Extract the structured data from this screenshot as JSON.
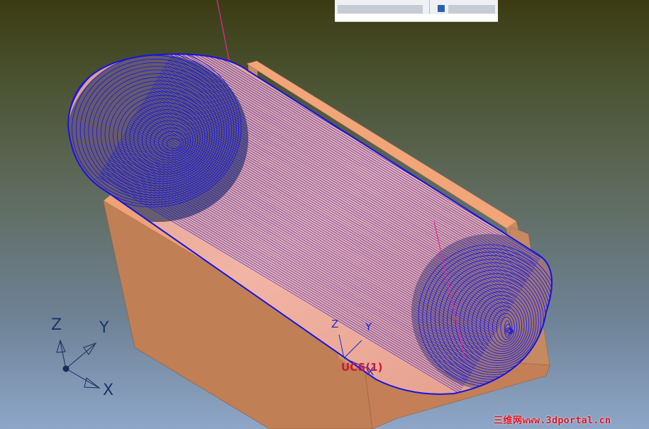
{
  "toolbar": {
    "left_text": "",
    "right_text": ""
  },
  "triad": {
    "z_label": "Z",
    "y_label": "Y",
    "x_label": "X"
  },
  "ucs": {
    "z_label": "Z",
    "y_label": "Y",
    "x_label": "X",
    "name": "UCS(1)"
  },
  "watermark": "三维网www.3dportal.cn",
  "colors": {
    "toolpath": "#1414e6",
    "part_face": "#c58a60",
    "part_top": "#f1a277",
    "machine_axis": "#e02aa0"
  }
}
